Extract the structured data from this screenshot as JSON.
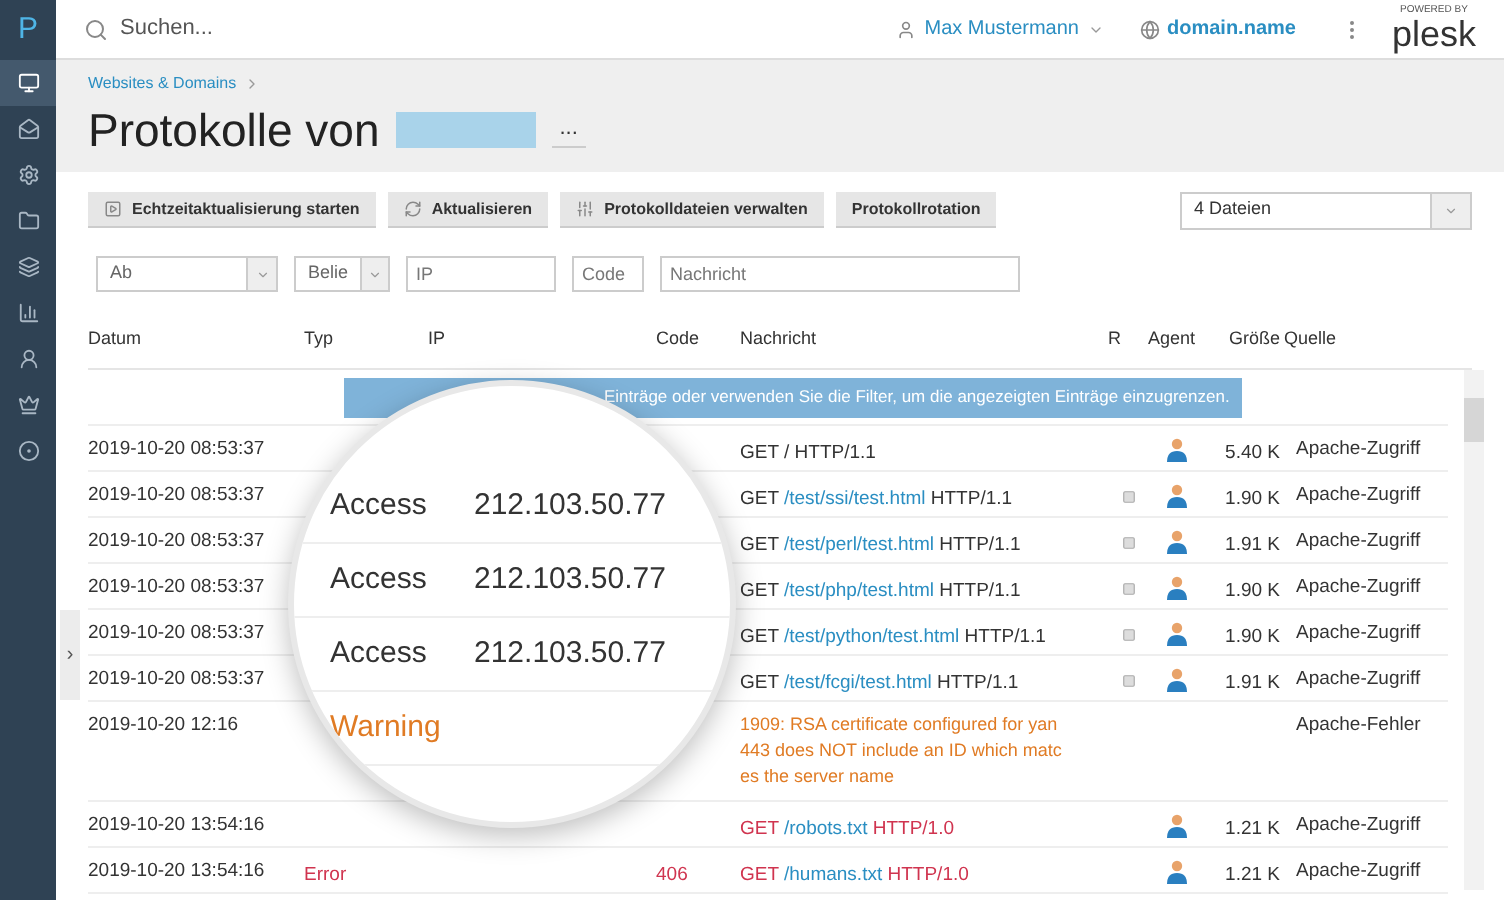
{
  "topbar": {
    "search": {
      "placeholder": "Suchen..."
    },
    "user": "Max Mustermann",
    "domain": "domain.name",
    "logo_caption": "POWERED BY",
    "logo": "plesk"
  },
  "sidebar": {
    "logo": "P",
    "items": [
      {
        "selected": true
      },
      {
        "selected": false
      },
      {
        "selected": false
      },
      {
        "selected": false
      },
      {
        "selected": false
      },
      {
        "selected": false
      },
      {
        "selected": false
      },
      {
        "selected": false
      },
      {
        "selected": false
      }
    ],
    "toggle": "›"
  },
  "breadcrumb": "Websites & Domains",
  "title": "Protokolle von",
  "title_more": "...",
  "toolbar": {
    "buttons": [
      {
        "label": "Echtzeitaktualisierung starten",
        "kind": "play"
      },
      {
        "label": "Aktualisieren",
        "kind": "refresh"
      },
      {
        "label": "Protokolldateien verwalten",
        "kind": "manage"
      },
      {
        "label": "Protokollrotation",
        "kind": "plain"
      }
    ],
    "files_select": "4 Dateien"
  },
  "filters": [
    {
      "kind": "select",
      "value": "Ab"
    },
    {
      "kind": "select",
      "value": "Belie"
    },
    {
      "kind": "input",
      "placeholder": "IP"
    },
    {
      "kind": "input",
      "placeholder": "Code"
    },
    {
      "kind": "input",
      "placeholder": "Nachricht"
    }
  ],
  "table": {
    "columns": [
      "Datum",
      "Typ",
      "IP",
      "Code",
      "Nachricht",
      "R",
      "Agent",
      "Größe",
      "Quelle"
    ],
    "banner": "Einträge oder verwenden Sie die Filter, um die angezeigten Einträge einzugrenzen.",
    "rows": [
      {
        "kind": "access",
        "date": "2019-10-20 08:53:37",
        "message": [
          {
            "kind": "plain",
            "text": "GET / HTTP/1.1"
          }
        ],
        "r": false,
        "agent": true,
        "size": "5.40 K",
        "source": "Apache-Zugriff"
      },
      {
        "kind": "access",
        "date": "2019-10-20 08:53:37",
        "message": [
          {
            "kind": "plain",
            "text": "GET"
          },
          {
            "kind": "link",
            "text": "/test/ssi/test.html"
          },
          {
            "kind": "plain",
            "text": "HTTP/1.1"
          }
        ],
        "r": true,
        "agent": true,
        "size": "1.90 K",
        "source": "Apache-Zugriff"
      },
      {
        "kind": "access",
        "date": "2019-10-20 08:53:37",
        "message": [
          {
            "kind": "plain",
            "text": "GET"
          },
          {
            "kind": "link",
            "text": "/test/perl/test.html"
          },
          {
            "kind": "plain",
            "text": "HTTP/1.1"
          }
        ],
        "r": true,
        "agent": true,
        "size": "1.91 K",
        "source": "Apache-Zugriff"
      },
      {
        "kind": "access",
        "date": "2019-10-20 08:53:37",
        "message": [
          {
            "kind": "plain",
            "text": "GET"
          },
          {
            "kind": "link",
            "text": "/test/php/test.html"
          },
          {
            "kind": "plain",
            "text": "HTTP/1.1"
          }
        ],
        "r": true,
        "agent": true,
        "size": "1.90 K",
        "source": "Apache-Zugriff"
      },
      {
        "kind": "access",
        "date": "2019-10-20 08:53:37",
        "message": [
          {
            "kind": "plain",
            "text": "GET"
          },
          {
            "kind": "link",
            "text": "/test/python/test.html"
          },
          {
            "kind": "plain",
            "text": "HTTP/1.1"
          }
        ],
        "r": true,
        "agent": true,
        "size": "1.90 K",
        "source": "Apache-Zugriff"
      },
      {
        "kind": "access",
        "date": "2019-10-20 08:53:37",
        "message": [
          {
            "kind": "plain",
            "text": "GET"
          },
          {
            "kind": "link",
            "text": "/test/fcgi/test.html"
          },
          {
            "kind": "plain",
            "text": "HTTP/1.1"
          }
        ],
        "r": true,
        "agent": true,
        "size": "1.91 K",
        "source": "Apache-Zugriff"
      },
      {
        "kind": "warning",
        "date": "2019-10-20 12:16",
        "message_lines": [
          "1909: RSA certificate configured for yan",
          "443 does NOT include an ID which matc",
          "es the server name"
        ],
        "r": false,
        "agent": false,
        "source": "Apache-Fehler"
      },
      {
        "kind": "error",
        "date": "2019-10-20 13:54:16",
        "message": [
          {
            "kind": "error",
            "text": "GET"
          },
          {
            "kind": "link",
            "text": "/robots.txt"
          },
          {
            "kind": "error",
            "text": "HTTP/1.0"
          }
        ],
        "r": false,
        "agent": true,
        "size": "1.21 K",
        "source": "Apache-Zugriff"
      },
      {
        "kind": "error",
        "date": "2019-10-20 13:54:16",
        "type": "Error",
        "code": "406",
        "message": [
          {
            "kind": "error",
            "text": "GET"
          },
          {
            "kind": "link",
            "text": "/humans.txt"
          },
          {
            "kind": "error",
            "text": "HTTP/1.0"
          }
        ],
        "r": false,
        "agent": true,
        "size": "1.21 K",
        "source": "Apache-Zugriff"
      }
    ]
  },
  "magnifier": {
    "rows": [
      {
        "kind": "access",
        "type": "Access",
        "ip": "212.103.50.77"
      },
      {
        "kind": "access",
        "type": "Access",
        "ip": "212.103.50.77"
      },
      {
        "kind": "access",
        "type": "Access",
        "ip": "212.103.50.77"
      },
      {
        "kind": "warning",
        "type": "Warning"
      }
    ]
  }
}
